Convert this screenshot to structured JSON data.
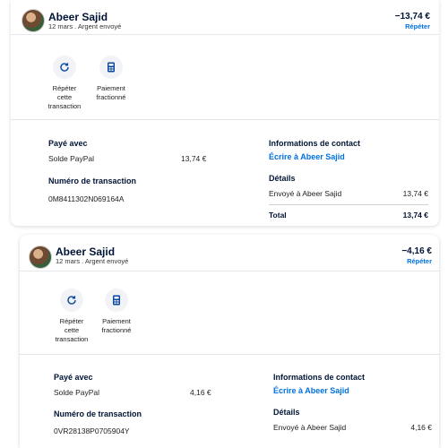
{
  "transactions": [
    {
      "name": "Abeer Sajid",
      "subtitle": "12 mars . Argent envoyé",
      "amount": "−13,74 €",
      "repeat_link": "Répéter",
      "actions": {
        "repeat_line1": "Répéter",
        "repeat_line2": "cette",
        "repeat_line3": "transaction",
        "split_line1": "Paiement",
        "split_line2": "fractionné"
      },
      "paid_with_title": "Payé avec",
      "paid_with_source": "Solde PayPal",
      "paid_with_amount": "13,74 €",
      "transaction_number_title": "Numéro de transaction",
      "transaction_number": "0M8411302N069164A",
      "contact_title": "Informations de contact",
      "contact_link": "Écrire à Abeer Sajid",
      "details_title": "Détails",
      "details_label": "Envoyé à Abeer Sajid",
      "details_amount": "13,74 €",
      "total_label": "Total",
      "total_amount": "13,74 €"
    },
    {
      "name": "Abeer Sajid",
      "subtitle": "12 mars . Argent envoyé",
      "amount": "−4,16 €",
      "repeat_link": "Répéter",
      "actions": {
        "repeat_line1": "Répéter",
        "repeat_line2": "cette",
        "repeat_line3": "transaction",
        "split_line1": "Paiement",
        "split_line2": "fractionné"
      },
      "paid_with_title": "Payé avec",
      "paid_with_source": "Solde PayPal",
      "paid_with_amount": "4,16 €",
      "transaction_number_title": "Numéro de transaction",
      "transaction_number": "0VR28138P0705904Y",
      "contact_title": "Informations de contact",
      "contact_link": "Écrire à Abeer Sajid",
      "details_title": "Détails",
      "details_label": "Envoyé à Abeer Sajid",
      "details_amount": "4,16 €"
    }
  ],
  "colors": {
    "link": "#0070e0",
    "text": "#001435",
    "icon": "#0d47a1"
  }
}
